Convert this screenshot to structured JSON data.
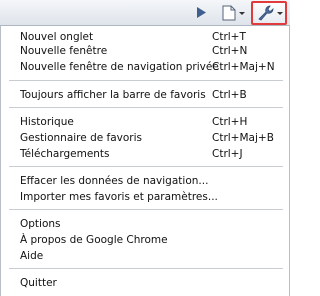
{
  "toolbar": {
    "buttons": [
      {
        "name": "play",
        "icon": "play-icon"
      },
      {
        "name": "page-menu",
        "icon": "page-icon",
        "has_dropdown": true
      },
      {
        "name": "wrench-menu",
        "icon": "wrench-icon",
        "has_dropdown": true,
        "highlighted": true
      }
    ],
    "highlight_color": "#e03a3a",
    "icon_color": "#4a6fa5"
  },
  "menu": {
    "groups": [
      {
        "items": [
          {
            "label": "Nouvel onglet",
            "shortcut": "Ctrl+T"
          },
          {
            "label": "Nouvelle fenêtre",
            "shortcut": "Ctrl+N"
          },
          {
            "label": "Nouvelle fenêtre de navigation privée",
            "shortcut": "Ctrl+Maj+N"
          }
        ]
      },
      {
        "items": [
          {
            "label": "Toujours afficher la barre de favoris",
            "shortcut": "Ctrl+B"
          }
        ]
      },
      {
        "items": [
          {
            "label": "Historique",
            "shortcut": "Ctrl+H"
          },
          {
            "label": "Gestionnaire de favoris",
            "shortcut": "Ctrl+Maj+B"
          },
          {
            "label": "Téléchargements",
            "shortcut": "Ctrl+J"
          }
        ]
      },
      {
        "items": [
          {
            "label": "Effacer les données de navigation...",
            "shortcut": ""
          },
          {
            "label": "Importer mes favoris et paramètres...",
            "shortcut": ""
          }
        ]
      },
      {
        "items": [
          {
            "label": "Options",
            "shortcut": ""
          },
          {
            "label": "À propos de Google Chrome",
            "shortcut": ""
          },
          {
            "label": "Aide",
            "shortcut": ""
          }
        ]
      },
      {
        "items": [
          {
            "label": "Quitter",
            "shortcut": ""
          }
        ]
      }
    ]
  }
}
